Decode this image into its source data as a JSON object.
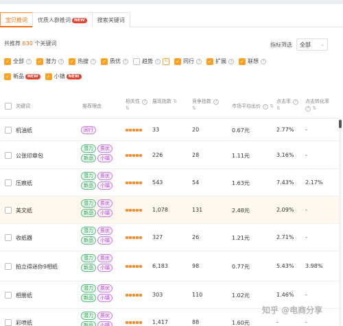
{
  "tabs": [
    {
      "label": "宝贝推词",
      "active": true,
      "badge": ""
    },
    {
      "label": "优质人群推词",
      "active": false,
      "badge": "NEW"
    },
    {
      "label": "搜索关键词",
      "active": false,
      "badge": ""
    }
  ],
  "summary": {
    "prefix": "共推荐",
    "count": "630",
    "suffix": "个关键词"
  },
  "filter": {
    "label": "指标筛选",
    "selected": "全部"
  },
  "checks_row1": [
    {
      "label": "全部",
      "checked": true
    },
    {
      "label": "潜力",
      "checked": true
    },
    {
      "label": "热搜",
      "checked": true
    },
    {
      "label": "质优",
      "checked": true
    },
    {
      "label": "趋势",
      "checked": false
    },
    {
      "label": "同行",
      "checked": true
    },
    {
      "label": "扩展",
      "checked": true
    },
    {
      "label": "联想",
      "checked": true
    }
  ],
  "checks_row2": [
    {
      "label": "新品",
      "checked": true,
      "badge": "NEW"
    },
    {
      "label": "小镇",
      "checked": true,
      "badge": "NEW"
    }
  ],
  "columns": {
    "keyword": "关键词",
    "reason": "推荐理由",
    "relevance": "相关性",
    "relevance_sort": "⇅",
    "exposure": "展现指数",
    "exposure_sort": "⇅",
    "competition": "竞争指数",
    "competition_sort": "⇅",
    "price": "市场平均出价",
    "price_sort": "⇅",
    "ctr": "点击率",
    "ctr_sort": "⇅",
    "cvr": "点击转化率",
    "cvr_sort": "⇅"
  },
  "rows": [
    {
      "keyword": "机油纸",
      "tags": [
        {
          "t": "同行",
          "c": "purple"
        }
      ],
      "relevance": 5,
      "exposure": "33",
      "competition": "20",
      "price": "0.67元",
      "ctr": "2.77%",
      "cvr": "-"
    },
    {
      "keyword": "公张印章包",
      "tags": [
        {
          "t": "潜力",
          "c": "green"
        },
        {
          "t": "质优",
          "c": "purple"
        },
        {
          "t": "新品",
          "c": "green"
        },
        {
          "t": "小镇",
          "c": "purple"
        }
      ],
      "relevance": 5,
      "exposure": "226",
      "competition": "28",
      "price": "1.11元",
      "ctr": "3.16%",
      "cvr": "-"
    },
    {
      "keyword": "压痕纸",
      "tags": [
        {
          "t": "潜力",
          "c": "green"
        },
        {
          "t": "质优",
          "c": "purple"
        },
        {
          "t": "新品",
          "c": "green"
        },
        {
          "t": "小镇",
          "c": "purple"
        }
      ],
      "relevance": 5,
      "exposure": "543",
      "competition": "54",
      "price": "1.63元",
      "ctr": "7.43%",
      "cvr": "2.17%"
    },
    {
      "keyword": "美文纸",
      "tags": [
        {
          "t": "潜力",
          "c": "green"
        },
        {
          "t": "质优",
          "c": "purple"
        },
        {
          "t": "新品",
          "c": "green"
        },
        {
          "t": "小镇",
          "c": "purple"
        }
      ],
      "relevance": 5,
      "exposure": "1,078",
      "competition": "131",
      "price": "2.48元",
      "ctr": "2.09%",
      "cvr": "-"
    },
    {
      "keyword": "收纸器",
      "tags": [
        {
          "t": "潜力",
          "c": "green"
        },
        {
          "t": "质优",
          "c": "purple"
        },
        {
          "t": "新品",
          "c": "green"
        },
        {
          "t": "小镇",
          "c": "purple"
        }
      ],
      "relevance": 5,
      "exposure": "327",
      "competition": "26",
      "price": "1.21元",
      "ctr": "2.71%",
      "cvr": "-"
    },
    {
      "keyword": "拍立得迷你9相纸",
      "tags": [
        {
          "t": "潜力",
          "c": "green"
        },
        {
          "t": "质优",
          "c": "purple"
        },
        {
          "t": "新品",
          "c": "green"
        },
        {
          "t": "小镇",
          "c": "purple"
        }
      ],
      "relevance": 5,
      "exposure": "6,183",
      "competition": "98",
      "price": "0.77元",
      "ctr": "5.43%",
      "cvr": "3.98%"
    },
    {
      "keyword": "相册纸",
      "tags": [
        {
          "t": "潜力",
          "c": "green"
        },
        {
          "t": "质优",
          "c": "purple"
        },
        {
          "t": "新品",
          "c": "green"
        },
        {
          "t": "小镇",
          "c": "purple"
        }
      ],
      "relevance": 5,
      "exposure": "303",
      "competition": "110",
      "price": "1.02元",
      "ctr": "1.46%",
      "cvr": "-"
    },
    {
      "keyword": "彩喷纸",
      "tags": [
        {
          "t": "潜力",
          "c": "green"
        },
        {
          "t": "质优",
          "c": "purple"
        },
        {
          "t": "新品",
          "c": "green"
        },
        {
          "t": "小镇",
          "c": "purple"
        }
      ],
      "relevance": 5,
      "exposure": "1,417",
      "competition": "88",
      "price": "1.60元",
      "ctr": "-",
      "cvr": "-"
    }
  ],
  "watermark": "知乎 @电商分享"
}
